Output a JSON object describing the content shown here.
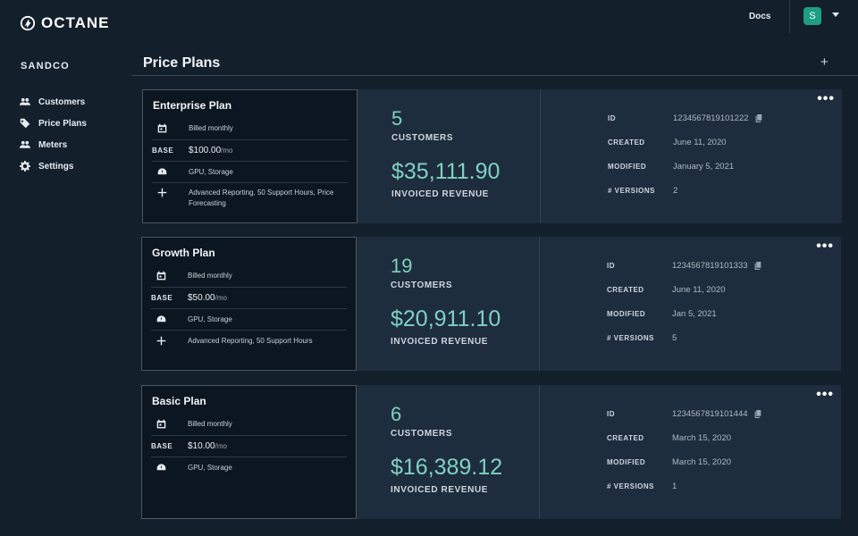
{
  "app": {
    "logo_text": "OCTANE",
    "docs_label": "Docs",
    "avatar_initial": "S"
  },
  "sidebar": {
    "org_name": "SANDCO",
    "items": [
      {
        "label": "Customers",
        "icon": "users-icon"
      },
      {
        "label": "Price Plans",
        "icon": "tag-icon"
      },
      {
        "label": "Meters",
        "icon": "users-icon"
      },
      {
        "label": "Settings",
        "icon": "gear-icon"
      }
    ]
  },
  "page": {
    "title": "Price Plans",
    "add_label": "+"
  },
  "labels": {
    "base": "BASE",
    "customers": "CUSTOMERS",
    "invoiced_revenue": "INVOICED REVENUE",
    "id": "ID",
    "created": "CREATED",
    "modified": "MODIFIED",
    "versions": "# VERSIONS",
    "more": "•••"
  },
  "plans": [
    {
      "name": "Enterprise Plan",
      "billing": "Billed monthly",
      "base_price": "$100.00",
      "price_unit": "/mo",
      "metrics": "GPU, Storage",
      "addons": "Advanced Reporting, 50 Support Hours, Price Forecasting",
      "customers": "5",
      "revenue": "$35,111.90",
      "id": "1234567819101222",
      "created": "June 11, 2020",
      "modified": "January 5, 2021",
      "versions": "2"
    },
    {
      "name": "Growth Plan",
      "billing": "Billed monthly",
      "base_price": "$50.00",
      "price_unit": "/mo",
      "metrics": "GPU, Storage",
      "addons": "Advanced Reporting, 50 Support Hours",
      "customers": "19",
      "revenue": "$20,911.10",
      "id": "1234567819101333",
      "created": "June 11, 2020",
      "modified": "Jan 5, 2021",
      "versions": "5"
    },
    {
      "name": "Basic Plan",
      "billing": "Billed monthly",
      "base_price": "$10.00",
      "price_unit": "/mo",
      "metrics": "GPU, Storage",
      "customers": "6",
      "revenue": "$16,389.12",
      "id": "1234567819101444",
      "created": "March 15, 2020",
      "modified": "March 15, 2020",
      "versions": "1"
    }
  ]
}
